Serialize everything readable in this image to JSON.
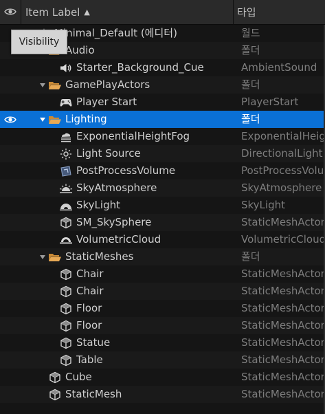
{
  "header": {
    "visibility_icon": "eye-icon",
    "item_label": "Item Label",
    "sort_icon": "sort-ascending-icon",
    "type_label": "타입"
  },
  "tooltip": {
    "text": "Visibility"
  },
  "colors": {
    "background": "#151515",
    "header_bg": "#2a2a2a",
    "selection": "#0a70d6",
    "folder": "#e0a450",
    "type_text": "#7d7d7d"
  },
  "rows": [
    {
      "label": "Minimal_Default (에디터)",
      "type": "월드",
      "icon": "world-icon",
      "depth": 0,
      "expanded": true
    },
    {
      "label": "Audio",
      "type": "폴더",
      "icon": "folder-open-icon",
      "depth": 1,
      "expanded": true
    },
    {
      "label": "Starter_Background_Cue",
      "type": "AmbientSound",
      "icon": "speaker-icon",
      "depth": 2
    },
    {
      "label": "GamePlayActors",
      "type": "폴더",
      "icon": "folder-open-icon",
      "depth": 1,
      "expanded": true
    },
    {
      "label": "Player Start",
      "type": "PlayerStart",
      "icon": "gamepad-icon",
      "depth": 2
    },
    {
      "label": "Lighting",
      "type": "폴더",
      "icon": "folder-open-icon",
      "depth": 1,
      "expanded": true,
      "selected": true,
      "visible": true
    },
    {
      "label": "ExponentialHeightFog",
      "type": "ExponentialHeightFog",
      "icon": "fog-icon",
      "depth": 2
    },
    {
      "label": "Light Source",
      "type": "DirectionalLight",
      "icon": "sun-icon",
      "depth": 2
    },
    {
      "label": "PostProcessVolume",
      "type": "PostProcessVolume",
      "icon": "post-process-volume-icon",
      "depth": 2
    },
    {
      "label": "SkyAtmosphere",
      "type": "SkyAtmosphere",
      "icon": "sky-atmosphere-icon",
      "depth": 2
    },
    {
      "label": "SkyLight",
      "type": "SkyLight",
      "icon": "sky-light-icon",
      "depth": 2
    },
    {
      "label": "SM_SkySphere",
      "type": "StaticMeshActor",
      "icon": "static-mesh-icon",
      "depth": 2
    },
    {
      "label": "VolumetricCloud",
      "type": "VolumetricCloud",
      "icon": "cloud-icon",
      "depth": 2
    },
    {
      "label": "StaticMeshes",
      "type": "폴더",
      "icon": "folder-open-icon",
      "depth": 1,
      "expanded": true
    },
    {
      "label": "Chair",
      "type": "StaticMeshActor",
      "icon": "static-mesh-icon",
      "depth": 2
    },
    {
      "label": "Chair",
      "type": "StaticMeshActor",
      "icon": "static-mesh-icon",
      "depth": 2
    },
    {
      "label": "Floor",
      "type": "StaticMeshActor",
      "icon": "static-mesh-icon",
      "depth": 2
    },
    {
      "label": "Floor",
      "type": "StaticMeshActor",
      "icon": "static-mesh-icon",
      "depth": 2
    },
    {
      "label": "Statue",
      "type": "StaticMeshActor",
      "icon": "static-mesh-icon",
      "depth": 2
    },
    {
      "label": "Table",
      "type": "StaticMeshActor",
      "icon": "static-mesh-icon",
      "depth": 2
    },
    {
      "label": "Cube",
      "type": "StaticMeshActor",
      "icon": "static-mesh-icon",
      "depth": 1
    },
    {
      "label": "StaticMesh",
      "type": "StaticMeshActor",
      "icon": "static-mesh-icon",
      "depth": 1
    }
  ]
}
